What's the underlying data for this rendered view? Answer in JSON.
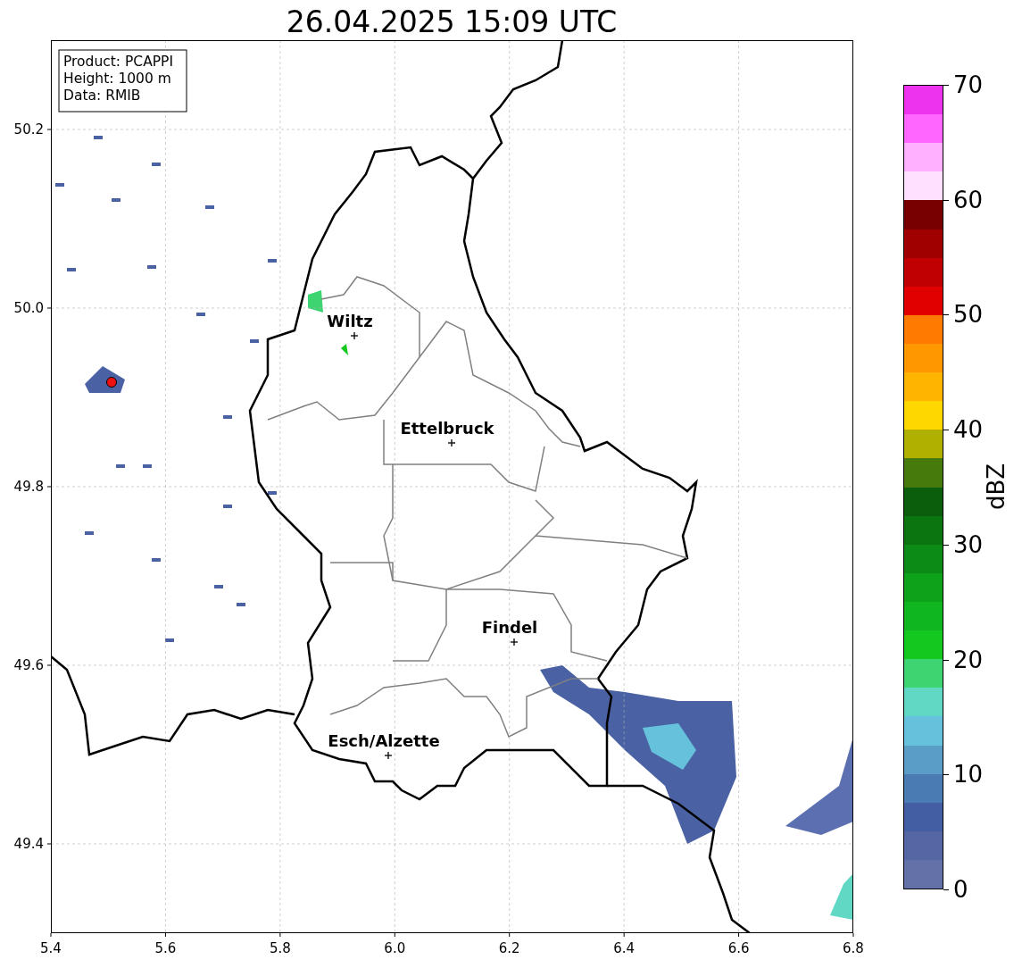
{
  "title": "26.04.2025 15:09 UTC",
  "map": {
    "info_box": [
      "Product: PCAPPI",
      "Height: 1000 m",
      "Data: RMIB"
    ],
    "x_axis_ticks": [
      "5.4",
      "5.6",
      "5.8",
      "6.0",
      "6.2",
      "6.4",
      "6.6",
      "6.8"
    ],
    "y_axis_ticks": [
      "50.2",
      "50.0",
      "49.8",
      "49.6",
      "49.4"
    ],
    "places": [
      {
        "name": "Wiltz"
      },
      {
        "name": "Ettelbruck"
      },
      {
        "name": "Findel"
      },
      {
        "name": "Esch/Alzette"
      }
    ]
  },
  "colorbar": {
    "label": "dBZ",
    "ticks": [
      "70",
      "60",
      "50",
      "40",
      "30",
      "20",
      "10",
      "0"
    ],
    "bands": [
      {
        "color": "#ee33ee"
      },
      {
        "color": "#ff66ff"
      },
      {
        "color": "#ffb0ff"
      },
      {
        "color": "#ffe0ff"
      },
      {
        "color": "#780000"
      },
      {
        "color": "#a00000"
      },
      {
        "color": "#c00000"
      },
      {
        "color": "#e00000"
      },
      {
        "color": "#ff7a00"
      },
      {
        "color": "#ff9800"
      },
      {
        "color": "#ffb400"
      },
      {
        "color": "#ffd700"
      },
      {
        "color": "#b0b000"
      },
      {
        "color": "#477a0c"
      },
      {
        "color": "#0a5e0c"
      },
      {
        "color": "#0b7510"
      },
      {
        "color": "#0c8b16"
      },
      {
        "color": "#0ea11a"
      },
      {
        "color": "#10b61f"
      },
      {
        "color": "#13c81f"
      },
      {
        "color": "#3dd572"
      },
      {
        "color": "#60d8c4"
      },
      {
        "color": "#66c1dc"
      },
      {
        "color": "#5a9ec8"
      },
      {
        "color": "#4a7bb3"
      },
      {
        "color": "#435ea3"
      },
      {
        "color": "#5466a3"
      },
      {
        "color": "#6470a8"
      }
    ]
  }
}
